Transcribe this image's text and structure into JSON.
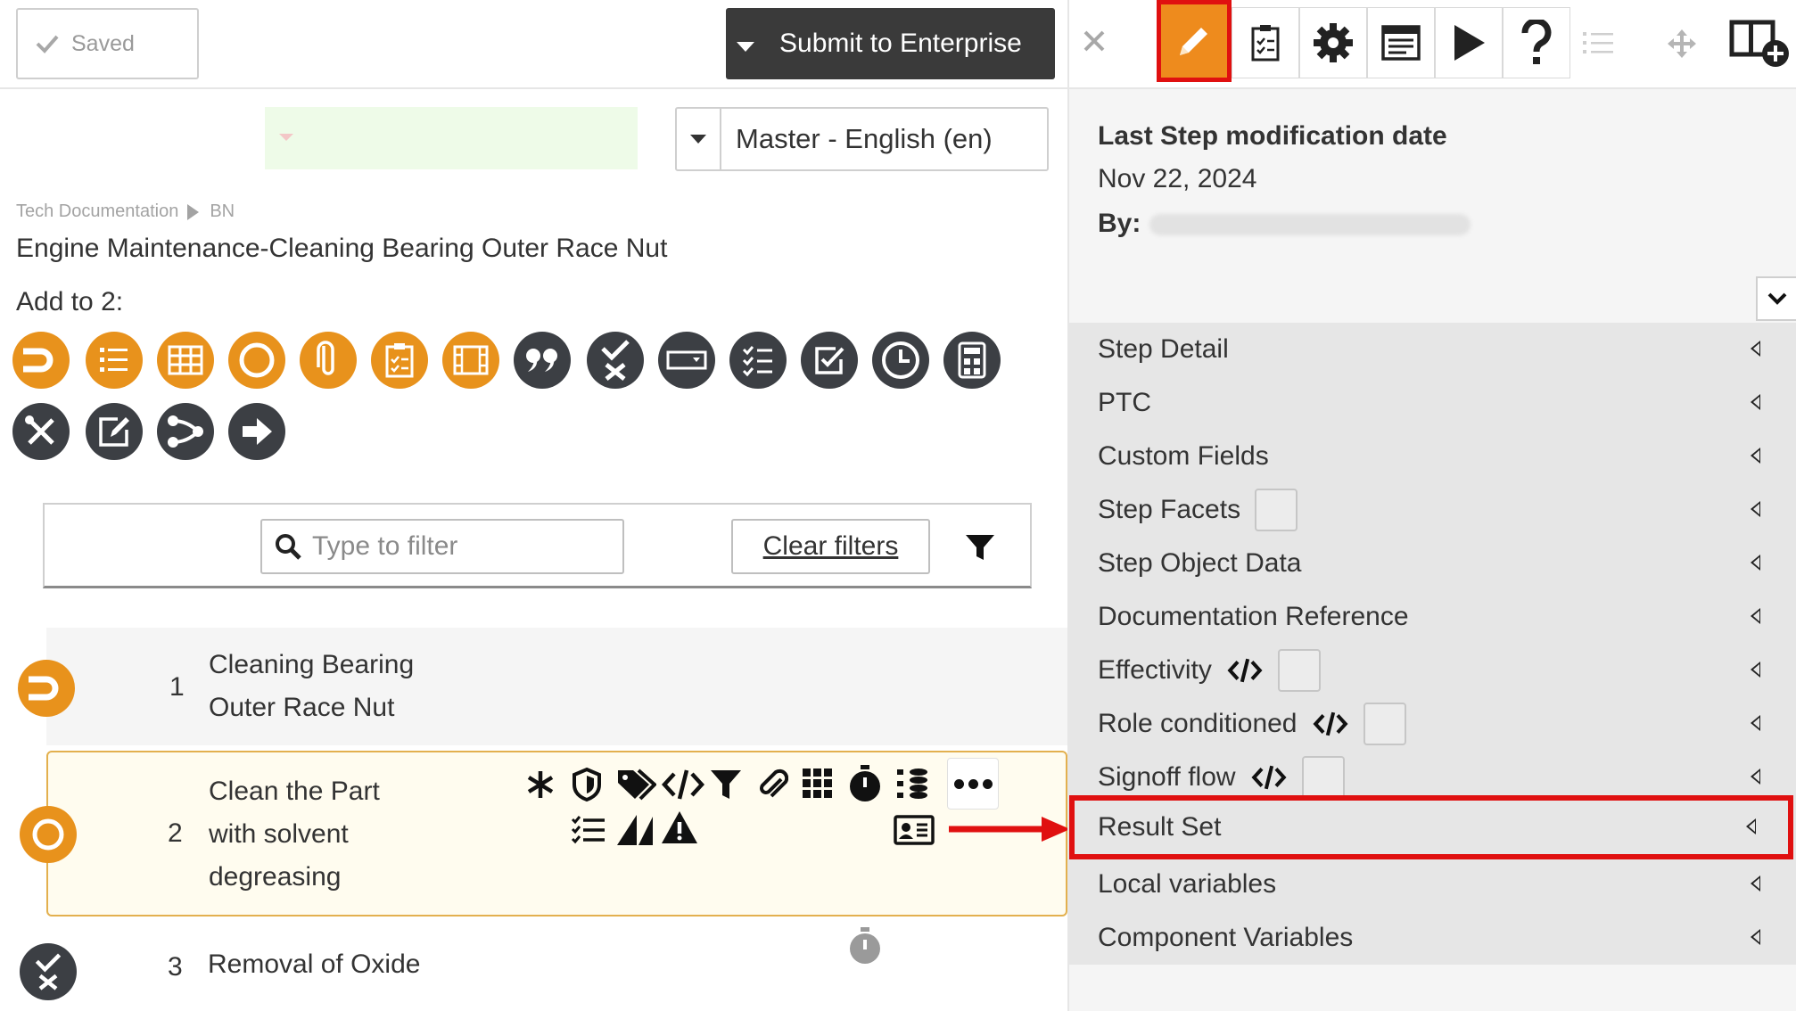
{
  "topbar": {
    "saved_label": "Saved",
    "submit_label": "Submit to Enterprise"
  },
  "language": {
    "selected": "Master - English (en)"
  },
  "breadcrumb": {
    "root": "Tech Documentation",
    "child": "BN"
  },
  "document": {
    "title": "Engine Maintenance-Cleaning Bearing Outer Race Nut",
    "add_to_label": "Add to 2:"
  },
  "filter": {
    "placeholder": "Type to filter",
    "clear_label": "Clear filters"
  },
  "steps": [
    {
      "num": "1",
      "line1": "Cleaning Bearing",
      "line2": "Outer Race Nut",
      "line3": ""
    },
    {
      "num": "2",
      "line1": "Clean the Part",
      "line2": "with solvent",
      "line3": "degreasing"
    },
    {
      "num": "3",
      "line1": "Removal of Oxide",
      "line2": "",
      "line3": ""
    }
  ],
  "right": {
    "meta_label": "Last Step modification date",
    "meta_date": "Nov 22, 2024",
    "by_label": "By:",
    "sections": [
      "Step Detail",
      "PTC",
      "Custom Fields",
      "Step Facets",
      "Step Object Data",
      "Documentation Reference",
      "Effectivity",
      "Role conditioned",
      "Signoff flow",
      "Result Set",
      "Local variables",
      "Component Variables"
    ]
  },
  "colors": {
    "accent_orange": "#e8921c",
    "dark_icon": "#3c3f44",
    "highlight_red": "#e01010",
    "step_highlight_bg": "#fffcef"
  }
}
